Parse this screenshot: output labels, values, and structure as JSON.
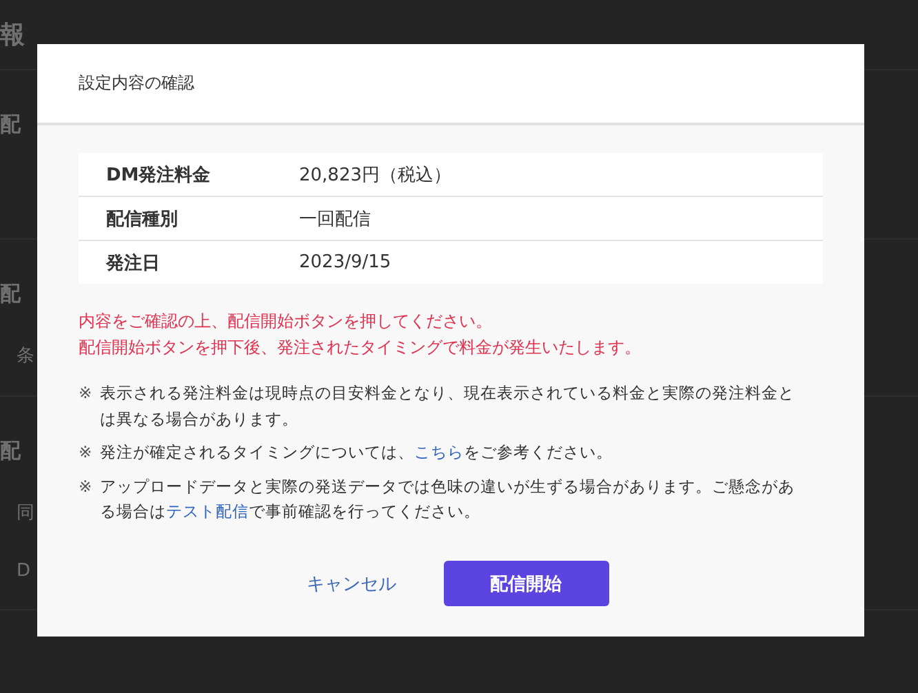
{
  "background": {
    "heading": "報",
    "sections": [
      {
        "title": "配"
      },
      {
        "title": "配",
        "items": [
          "条"
        ]
      },
      {
        "title": "配",
        "items": [
          "同",
          "D"
        ]
      }
    ]
  },
  "dialog": {
    "title": "設定内容の確認",
    "summary": [
      {
        "label": "DM発注料金",
        "value": "20,823円（税込）"
      },
      {
        "label": "配信種別",
        "value": "一回配信"
      },
      {
        "label": "発注日",
        "value": "2023/9/15"
      }
    ],
    "warnings": [
      "内容をご確認の上、配信開始ボタンを押してください。",
      "配信開始ボタンを押下後、発注されたタイミングで料金が発生いたします。"
    ],
    "notes": [
      {
        "mark": "※",
        "parts": [
          {
            "kind": "text",
            "text": "表示される発注料金は現時点の目安料金となり、現在表示されている料金と実際の発注料金とは異なる場合があります。"
          }
        ]
      },
      {
        "mark": "※",
        "parts": [
          {
            "kind": "text",
            "text": "発注が確定されるタイミングについては、"
          },
          {
            "kind": "link",
            "text": "こちら"
          },
          {
            "kind": "text",
            "text": "をご参考ください。"
          }
        ]
      },
      {
        "mark": "※",
        "parts": [
          {
            "kind": "text",
            "text": "アップロードデータと実際の発送データでは色味の違いが生ずる場合があります。ご懸念がある場合は"
          },
          {
            "kind": "link",
            "text": "テスト配信"
          },
          {
            "kind": "text",
            "text": "で事前確認を行ってください。"
          }
        ]
      }
    ],
    "buttons": [
      {
        "label": "キャンセル",
        "kind": "secondary"
      },
      {
        "label": "配信開始",
        "kind": "primary"
      }
    ]
  }
}
